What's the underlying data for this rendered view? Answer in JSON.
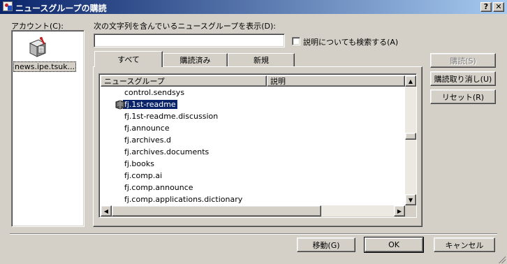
{
  "window": {
    "title": "ニュースグループの購読",
    "help_button": "?",
    "close_button": "X"
  },
  "account": {
    "label": "アカウント(C):",
    "items": [
      {
        "name": "news.ipe.tsuk..."
      }
    ]
  },
  "filter": {
    "label": "次の文字列を含んでいるニュースグループを表示(D):",
    "value": "",
    "placeholder": "",
    "search_descriptions_label": "説明についても検索する(A)",
    "search_descriptions_checked": false
  },
  "tabs": [
    {
      "label": "すべて",
      "active": true
    },
    {
      "label": "購読済み",
      "active": false
    },
    {
      "label": "新規",
      "active": false
    }
  ],
  "list": {
    "columns": [
      "ニュースグループ",
      "説明"
    ],
    "rows": [
      {
        "name": "control.sendsys",
        "subscribed": false,
        "selected": false
      },
      {
        "name": "fj.1st-readme",
        "subscribed": true,
        "selected": true
      },
      {
        "name": "fj.1st-readme.discussion",
        "subscribed": false,
        "selected": false
      },
      {
        "name": "fj.announce",
        "subscribed": false,
        "selected": false
      },
      {
        "name": "fj.archives.d",
        "subscribed": false,
        "selected": false
      },
      {
        "name": "fj.archives.documents",
        "subscribed": false,
        "selected": false
      },
      {
        "name": "fj.books",
        "subscribed": false,
        "selected": false
      },
      {
        "name": "fj.comp.ai",
        "subscribed": false,
        "selected": false
      },
      {
        "name": "fj.comp.announce",
        "subscribed": false,
        "selected": false
      },
      {
        "name": "fj.comp.applications.dictionary",
        "subscribed": false,
        "selected": false
      }
    ]
  },
  "side_buttons": {
    "subscribe": "購読(S)",
    "unsubscribe": "購読取り消し(U)",
    "reset": "リセット(R)"
  },
  "footer": {
    "goto": "移動(G)",
    "ok": "OK",
    "cancel": "キャンセル"
  },
  "colors": {
    "titlebar_start": "#0a246a",
    "titlebar_end": "#a6caf0",
    "selection": "#0a246a",
    "face": "#d4d0c8"
  }
}
